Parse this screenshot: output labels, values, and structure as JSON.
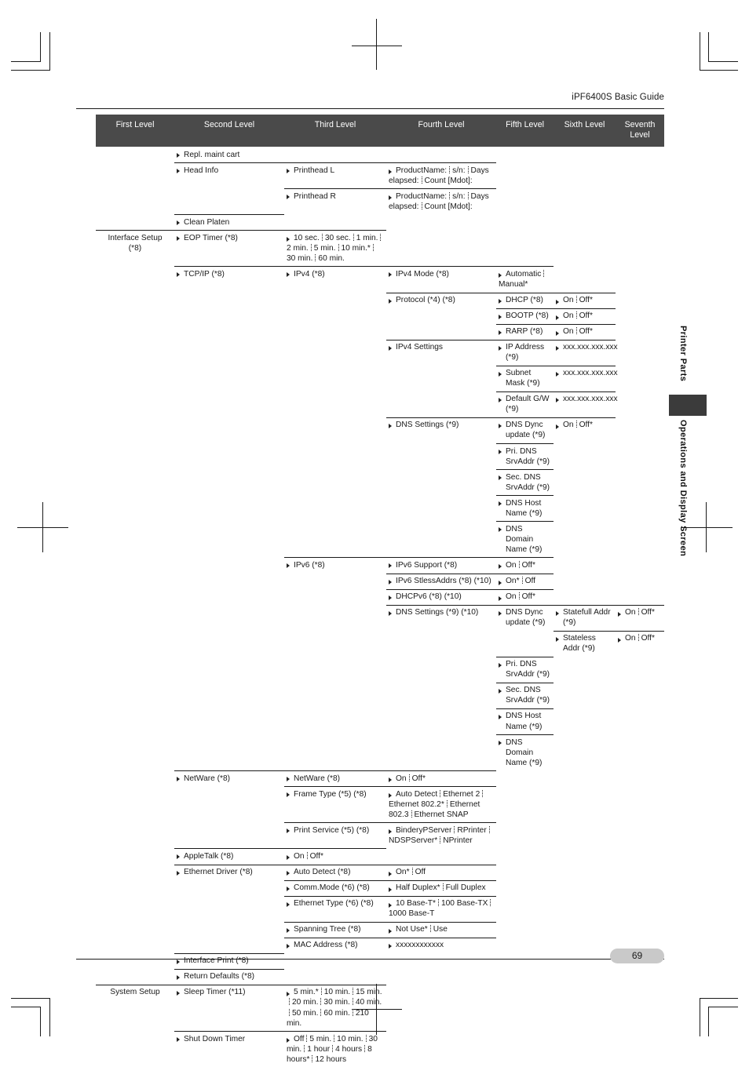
{
  "header": {
    "title": "iPF6400S Basic Guide"
  },
  "side_tabs": {
    "printer_parts": "Printer Parts",
    "operations_display": "Operations and Display Screen"
  },
  "footer": {
    "page_number": "69"
  },
  "table": {
    "columns": [
      "First Level",
      "Second Level",
      "Third Level",
      "Fourth Level",
      "Fifth Level",
      "Sixth Level",
      "Seventh Level"
    ],
    "rows": [
      {
        "c2": "Repl. maint cart"
      },
      {
        "c2": "Head Info",
        "c3": "Printhead L",
        "c4": "ProductName:|s/n:|Days elapsed:|Count [Mdot]:"
      },
      {
        "c3": "Printhead R",
        "c4": "ProductName:|s/n:|Days elapsed:|Count [Mdot]:"
      },
      {
        "c2": "Clean Platen"
      },
      {
        "c1": "Interface Setup (*8)",
        "c2": "EOP Timer (*8)",
        "c3": "10 sec.|30 sec.|1 min.|2 min.|5 min.|10 min.*|30 min.|60 min."
      },
      {
        "c2": "TCP/IP (*8)",
        "c3": "IPv4 (*8)",
        "c4": "IPv4 Mode (*8)",
        "c5": "Automatic|Manual*"
      },
      {
        "c4": "Protocol (*4) (*8)",
        "c5": "DHCP (*8)",
        "c6": "On|Off*"
      },
      {
        "c5": "BOOTP (*8)",
        "c6": "On|Off*"
      },
      {
        "c5": "RARP (*8)",
        "c6": "On|Off*"
      },
      {
        "c4": "IPv4 Settings",
        "c5": "IP Address (*9)",
        "c6": "xxx.xxx.xxx.xxx"
      },
      {
        "c5": "Subnet Mask (*9)",
        "c6": "xxx.xxx.xxx.xxx"
      },
      {
        "c5": "Default G/W (*9)",
        "c6": "xxx.xxx.xxx.xxx"
      },
      {
        "c4": "DNS Settings (*9)",
        "c5": "DNS Dync update (*9)",
        "c6": "On|Off*"
      },
      {
        "c5": "Pri. DNS SrvAddr (*9)"
      },
      {
        "c5": "Sec. DNS SrvAddr (*9)"
      },
      {
        "c5": "DNS Host Name (*9)"
      },
      {
        "c5": "DNS Domain Name (*9)"
      },
      {
        "c3": "IPv6 (*8)",
        "c4": "IPv6 Support (*8)",
        "c5": "On|Off*"
      },
      {
        "c4": "IPv6 StlessAddrs (*8) (*10)",
        "c5": "On*|Off"
      },
      {
        "c4": "DHCPv6 (*8) (*10)",
        "c5": "On|Off*"
      },
      {
        "c4": "DNS Settings (*9) (*10)",
        "c5": "DNS Dync update (*9)",
        "c6": "Statefull Addr (*9)",
        "c7": "On|Off*"
      },
      {
        "c6": "Stateless Addr (*9)",
        "c7": "On|Off*"
      },
      {
        "c5": "Pri. DNS SrvAddr (*9)"
      },
      {
        "c5": "Sec. DNS SrvAddr (*9)"
      },
      {
        "c5": "DNS Host Name (*9)"
      },
      {
        "c5": "DNS Domain Name (*9)"
      },
      {
        "c2": "NetWare (*8)",
        "c3": "NetWare (*8)",
        "c4": "On|Off*"
      },
      {
        "c3": "Frame Type (*5) (*8)",
        "c4": "Auto Detect|Ethernet 2|Ethernet 802.2*|Ethernet 802.3|Ethernet SNAP"
      },
      {
        "c3": "Print Service (*5) (*8)",
        "c4": "BinderyPServer|RPrinter|NDSPServer*|NPrinter"
      },
      {
        "c2": "AppleTalk (*8)",
        "c3": "On|Off*"
      },
      {
        "c2": "Ethernet Driver (*8)",
        "c3": "Auto Detect (*8)",
        "c4": "On*|Off"
      },
      {
        "c3": "Comm.Mode (*6) (*8)",
        "c4": "Half Duplex*|Full Duplex"
      },
      {
        "c3": "Ethernet Type (*6) (*8)",
        "c4": "10 Base-T*|100 Base-TX|1000 Base-T"
      },
      {
        "c3": "Spanning Tree (*8)",
        "c4": "Not Use*|Use"
      },
      {
        "c3": "MAC Address (*8)",
        "c4": "xxxxxxxxxxxx"
      },
      {
        "c2": "Interface Print (*8)"
      },
      {
        "c2": "Return Defaults (*8)"
      },
      {
        "c1": "System Setup",
        "c2": "Sleep Timer (*11)",
        "c3": "5 min.*|10 min.|15 min.|20 min.|30 min.|40 min.|50 min.|60 min.|210 min."
      },
      {
        "c2": "Shut Down Timer",
        "c3": "Off|5 min.|10 min.|30 min.|1 hour|4 hours|8 hours*|12 hours"
      }
    ]
  }
}
